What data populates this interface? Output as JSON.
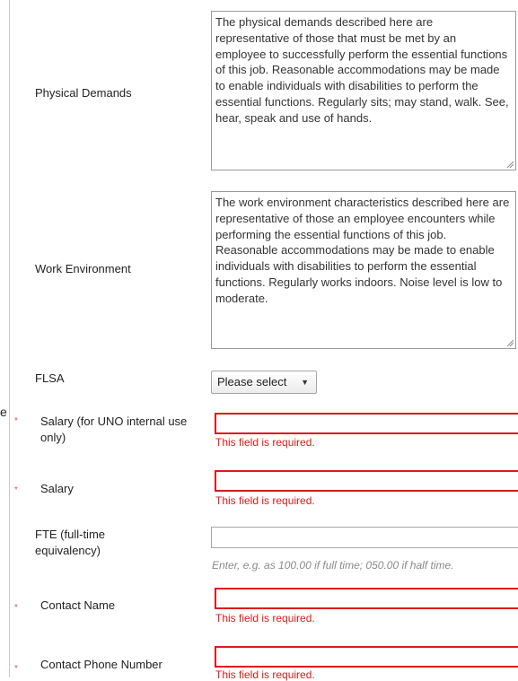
{
  "left_edge_text": "e",
  "fields": {
    "physical_demands": {
      "label": "Physical Demands",
      "value": "The physical demands described here are representative of those that must be met by an employee to successfully perform the essential functions of this job. Reasonable accommodations may be made to enable individuals with disabilities to perform the essential functions. Regularly sits; may stand, walk. See, hear, speak and use of hands."
    },
    "work_environment": {
      "label": "Work Environment",
      "value": "The work environment characteristics described here are representative of those an employee encounters while performing the essential functions of this job. Reasonable accommodations may be made to enable individuals with disabilities to perform the essential functions. Regularly works indoors. Noise level is low to moderate."
    },
    "flsa": {
      "label": "FLSA",
      "selected": "Please select",
      "arrow": "▼"
    },
    "salary_internal": {
      "label": "Salary (for UNO internal use only)",
      "value": "",
      "required": true,
      "error": "This field is required."
    },
    "salary": {
      "label": "Salary",
      "value": "",
      "required": true,
      "error": "This field is required."
    },
    "fte": {
      "label": "FTE (full-time equivalency)",
      "value": "",
      "hint": "Enter, e.g. as 100.00 if full time; 050.00 if half time."
    },
    "contact_name": {
      "label": "Contact Name",
      "value": "",
      "required": true,
      "error": "This field is required."
    },
    "contact_phone": {
      "label": "Contact Phone Number",
      "value": "",
      "required": true,
      "error": "This field is required."
    }
  },
  "required_marker": "*",
  "colors": {
    "error": "#e01818",
    "required_star": "#e05a3a",
    "hint": "#8a8a8a"
  }
}
